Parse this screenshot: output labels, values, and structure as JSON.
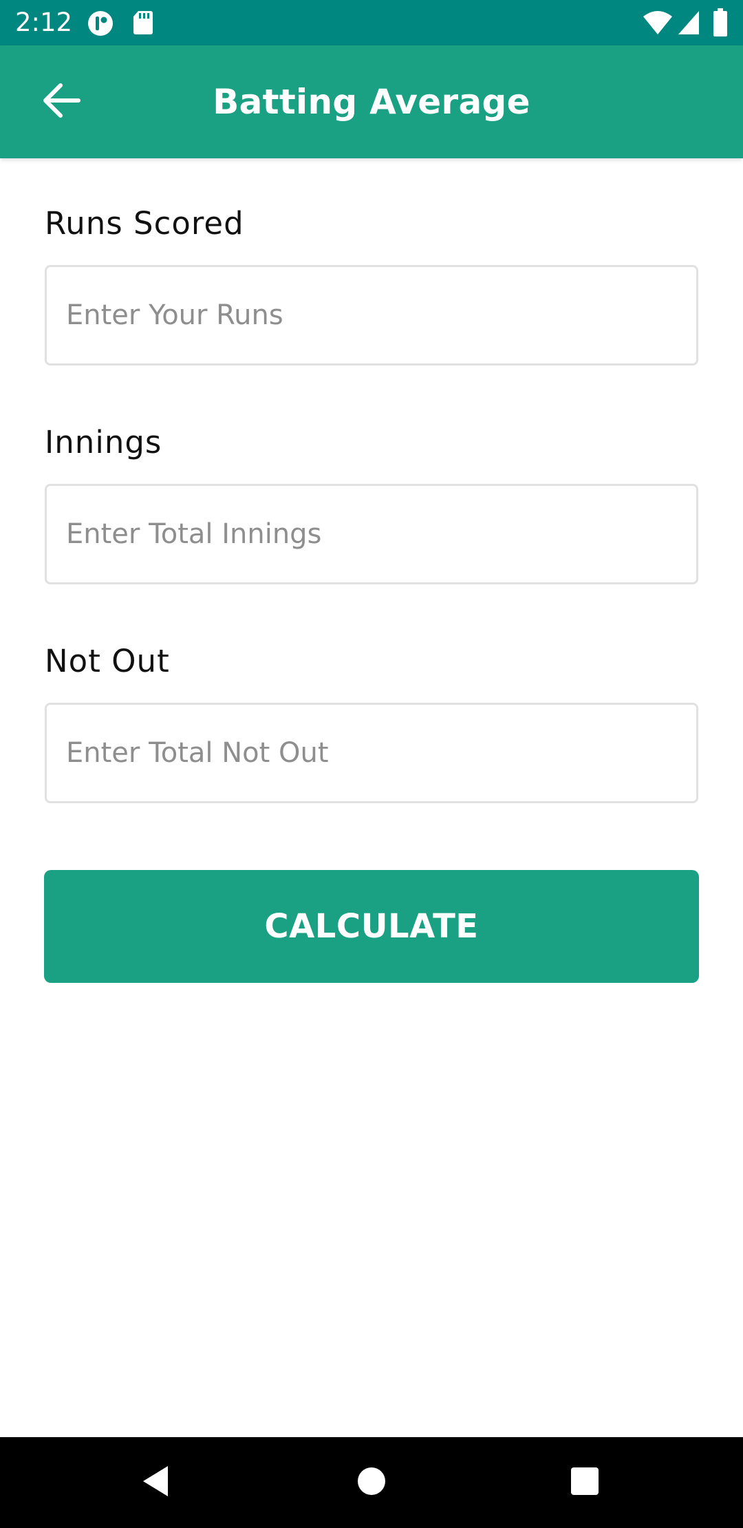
{
  "status_bar": {
    "time": "2:12",
    "icons": [
      "notification-app-icon",
      "sd-card-icon",
      "wifi-icon",
      "cellular-signal-icon",
      "battery-icon"
    ]
  },
  "app_bar": {
    "title": "Batting Average",
    "back_icon": "arrow-left-icon",
    "color": "#1aa183"
  },
  "form": {
    "runs": {
      "label": "Runs Scored",
      "placeholder": "Enter Your Runs",
      "value": ""
    },
    "innings": {
      "label": "Innings",
      "placeholder": "Enter Total Innings",
      "value": ""
    },
    "not_out": {
      "label": "Not Out",
      "placeholder": "Enter Total Not Out",
      "value": ""
    },
    "calculate_label": "CALCULATE"
  },
  "nav_bar": {
    "icons": [
      "back-triangle-icon",
      "home-circle-icon",
      "recents-square-icon"
    ]
  },
  "colors": {
    "status_bar": "#00877f",
    "accent": "#1aa183",
    "input_border": "#e1e1e1"
  }
}
